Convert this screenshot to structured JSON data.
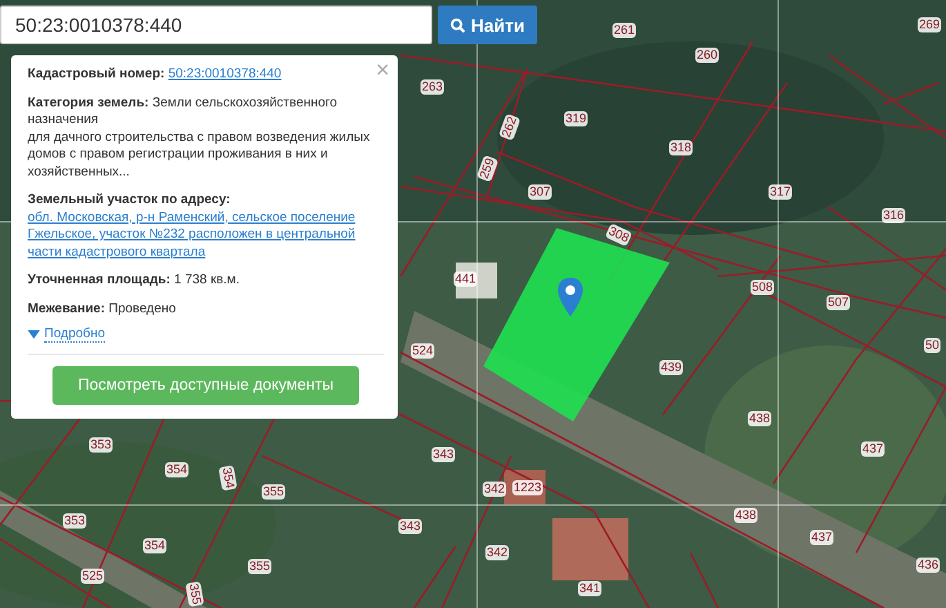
{
  "search": {
    "value": "50:23:0010378:440",
    "button": "Найти"
  },
  "popup": {
    "close": "×",
    "fields": [
      {
        "kind": "link",
        "label": "Кадастровый номер:",
        "value": "50:23:0010378:440"
      },
      {
        "kind": "text",
        "label": "Категория земель:",
        "value": "Земли сельскохозяйственного назначения",
        "details": "для дачного строительства с правом возведения жилых домов с правом регистрации проживания в них и хозяйственных..."
      },
      {
        "kind": "link",
        "label": "Земельный участок по адресу:",
        "value": "обл. Московская, р-н Раменский, сельское поселение Гжельское, участок №232 расположен в центральной части кадастрового квартала"
      },
      {
        "kind": "text",
        "label": "Уточненная площадь:",
        "value": "1 738 кв.м."
      },
      {
        "kind": "text",
        "label": "Межевание:",
        "value": "Проведено"
      }
    ],
    "more": {
      "label": "Подробно",
      "expanded": false
    },
    "action": "Посмотреть доступные документы"
  },
  "parcel_labels": [
    "261",
    "260",
    "269",
    "263",
    "262",
    "319",
    "318",
    "259",
    "307",
    "317",
    "316",
    "308",
    "441",
    "508",
    "507",
    "50",
    "524",
    "439",
    "438",
    "437",
    "343",
    "342",
    "1223",
    "438",
    "437",
    "436",
    "343",
    "342",
    "341",
    "353",
    "354",
    "354",
    "355",
    "353",
    "354",
    "355",
    "525",
    "355"
  ]
}
